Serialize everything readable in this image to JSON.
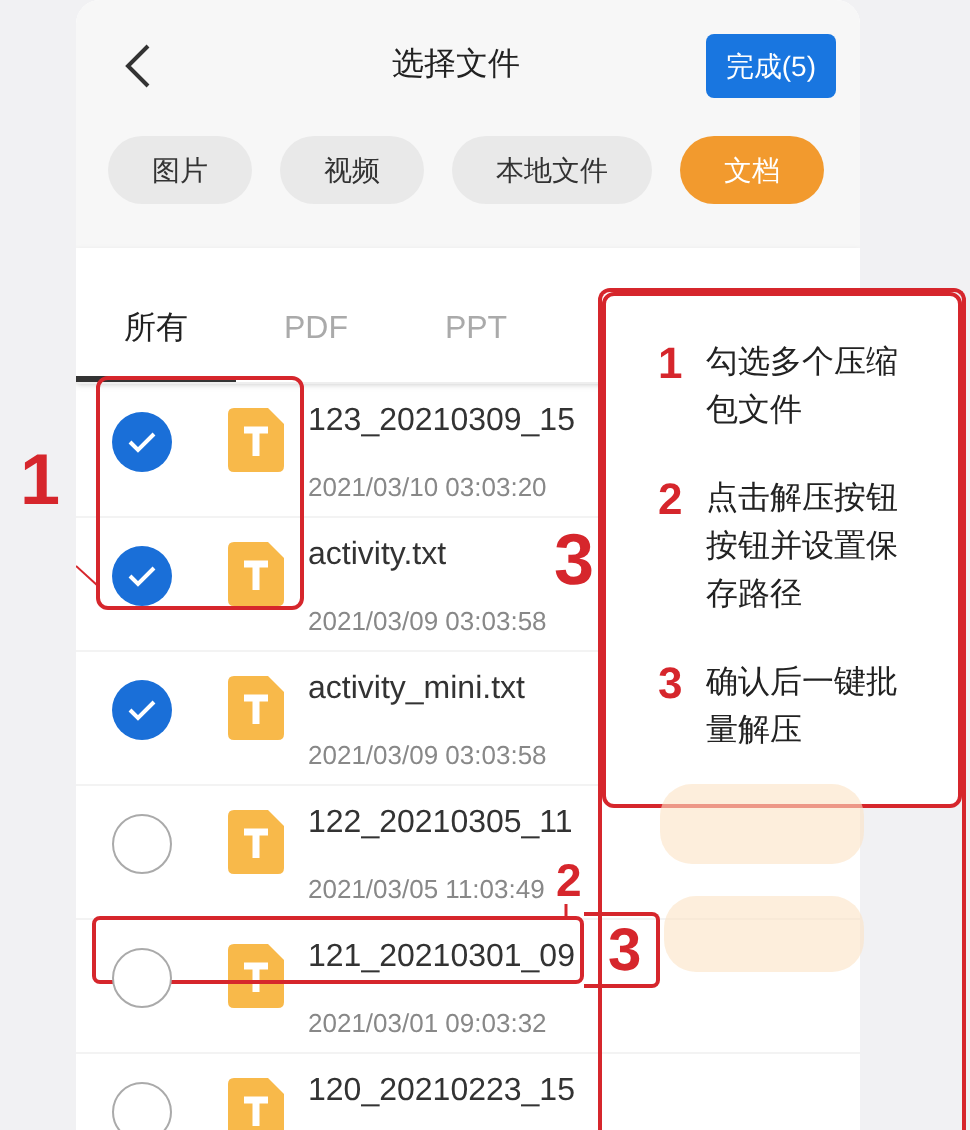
{
  "header": {
    "title": "选择文件",
    "done_button": "完成(5)"
  },
  "filter_chips": [
    {
      "label": "图片",
      "selected": false
    },
    {
      "label": "视频",
      "selected": false
    },
    {
      "label": "本地文件",
      "selected": false
    },
    {
      "label": "文档",
      "selected": true
    }
  ],
  "tabs": [
    {
      "label": "所有",
      "selected": true
    },
    {
      "label": "PDF",
      "selected": false
    },
    {
      "label": "PPT",
      "selected": false
    }
  ],
  "files": [
    {
      "name": "123_20210309_15",
      "date": "2021/03/10 03:03:20",
      "checked": true
    },
    {
      "name": "activity.txt",
      "date": "2021/03/09 03:03:58",
      "checked": true
    },
    {
      "name": "activity_mini.txt",
      "date": "2021/03/09 03:03:58",
      "checked": true
    },
    {
      "name": "122_20210305_11",
      "date": "2021/03/05 11:03:49",
      "checked": false
    },
    {
      "name": "121_20210301_09",
      "date": "2021/03/01 09:03:32",
      "checked": false
    },
    {
      "name": "120_20210223_15",
      "checked": false
    }
  ],
  "annotations": {
    "labels": [
      "1",
      "3",
      "2",
      "3"
    ],
    "steps": [
      {
        "number": "1",
        "text": "勾选多个压缩包文件"
      },
      {
        "number": "2",
        "text": "点击解压按钮按钮并设置保存路径"
      },
      {
        "number": "3",
        "text": "确认后一键批量解压"
      }
    ]
  }
}
